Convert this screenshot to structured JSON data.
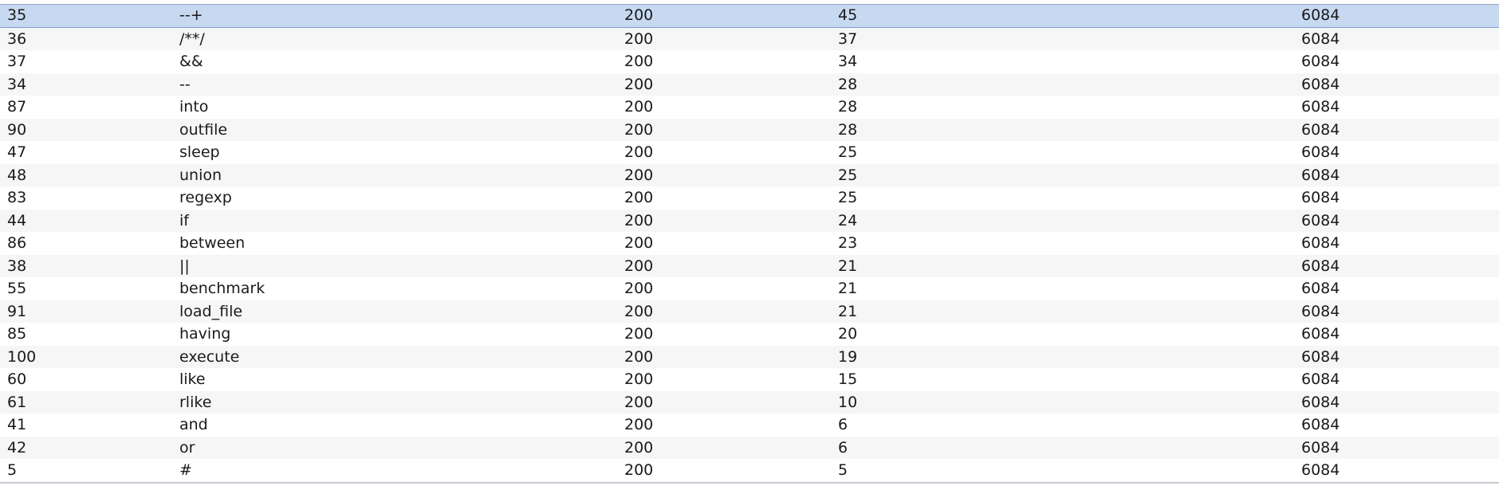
{
  "results": {
    "rows": [
      {
        "request": "35",
        "payload": "--+",
        "status": "200",
        "length": "45",
        "size": "6084"
      },
      {
        "request": "36",
        "payload": "/**/",
        "status": "200",
        "length": "37",
        "size": "6084"
      },
      {
        "request": "37",
        "payload": "&&",
        "status": "200",
        "length": "34",
        "size": "6084"
      },
      {
        "request": "34",
        "payload": "--",
        "status": "200",
        "length": "28",
        "size": "6084"
      },
      {
        "request": "87",
        "payload": "into",
        "status": "200",
        "length": "28",
        "size": "6084"
      },
      {
        "request": "90",
        "payload": "outfile",
        "status": "200",
        "length": "28",
        "size": "6084"
      },
      {
        "request": "47",
        "payload": "sleep",
        "status": "200",
        "length": "25",
        "size": "6084"
      },
      {
        "request": "48",
        "payload": "union",
        "status": "200",
        "length": "25",
        "size": "6084"
      },
      {
        "request": "83",
        "payload": "regexp",
        "status": "200",
        "length": "25",
        "size": "6084"
      },
      {
        "request": "44",
        "payload": "if",
        "status": "200",
        "length": "24",
        "size": "6084"
      },
      {
        "request": "86",
        "payload": "between",
        "status": "200",
        "length": "23",
        "size": "6084"
      },
      {
        "request": "38",
        "payload": "||",
        "status": "200",
        "length": "21",
        "size": "6084"
      },
      {
        "request": "55",
        "payload": "benchmark",
        "status": "200",
        "length": "21",
        "size": "6084"
      },
      {
        "request": "91",
        "payload": "load_file",
        "status": "200",
        "length": "21",
        "size": "6084"
      },
      {
        "request": "85",
        "payload": "having",
        "status": "200",
        "length": "20",
        "size": "6084"
      },
      {
        "request": "100",
        "payload": "execute",
        "status": "200",
        "length": "19",
        "size": "6084"
      },
      {
        "request": "60",
        "payload": "like",
        "status": "200",
        "length": "15",
        "size": "6084"
      },
      {
        "request": "61",
        "payload": "rlike",
        "status": "200",
        "length": "10",
        "size": "6084"
      },
      {
        "request": "41",
        "payload": "and",
        "status": "200",
        "length": "6",
        "size": "6084"
      },
      {
        "request": "42",
        "payload": "or",
        "status": "200",
        "length": "6",
        "size": "6084"
      },
      {
        "request": "5",
        "payload": "#",
        "status": "200",
        "length": "5",
        "size": "6084"
      }
    ],
    "selected_index": 0
  },
  "colors": {
    "selected_row": "#c7d9f1",
    "alt_row": "#f6f6f6"
  }
}
